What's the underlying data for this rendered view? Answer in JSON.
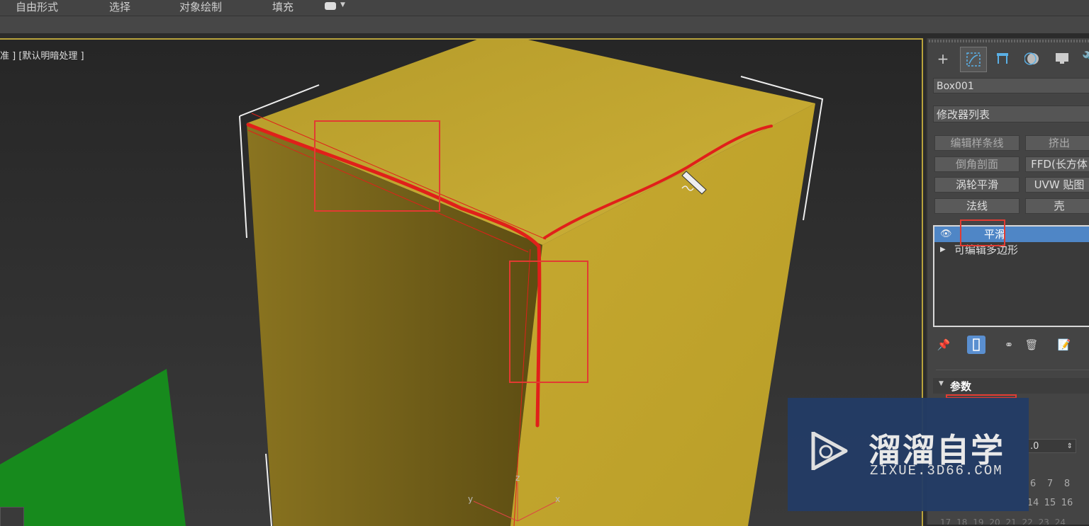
{
  "menubar": {
    "items": [
      "自由形式",
      "选择",
      "对象绘制",
      "填充"
    ],
    "dropdown_icon": "speech-bubble-icon"
  },
  "viewport": {
    "label": "准 ] [默认明暗处理 ]",
    "axis_labels": {
      "z": "z",
      "y": "y",
      "x": "x"
    },
    "colors": {
      "box": "#c8a82c",
      "ground": "#178a1d",
      "annotation": "#e0201a",
      "frame": "#b9a33c"
    }
  },
  "command_panel": {
    "tabs": [
      "create-icon",
      "modify-icon",
      "hierarchy-icon",
      "motion-icon",
      "display-icon",
      "utilities-icon"
    ],
    "object_name": "Box001",
    "modifier_list": "修改器列表",
    "buttons": [
      [
        "编辑样条线",
        "挤出"
      ],
      [
        "倒角剖面",
        "FFD(长方体"
      ],
      [
        "涡轮平滑",
        "UVW 贴图"
      ],
      [
        "法线",
        "壳"
      ]
    ],
    "stack": {
      "selected": "平滑",
      "item": "可编辑多边形"
    },
    "rollout_title": "参数",
    "spinner_value": ".0",
    "groups": [
      "6",
      "7",
      "8",
      "14",
      "15",
      "16",
      "17",
      "18",
      "19",
      "20",
      "21",
      "22",
      "23",
      "24"
    ]
  },
  "watermark": {
    "title": "溜溜自学",
    "url": "ZIXUE.3D66.COM"
  }
}
